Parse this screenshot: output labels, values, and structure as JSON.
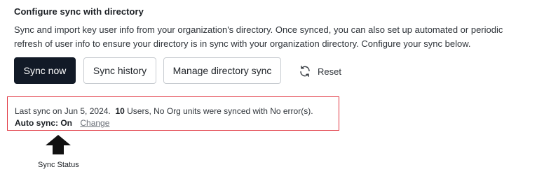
{
  "section": {
    "title": "Configure sync with directory",
    "description": "Sync and import key user info from your organization's directory. Once synced, you can also set up automated or periodic refresh of user info to ensure your directory is in sync with your organization directory. Configure your sync below."
  },
  "actions": {
    "sync_now": "Sync now",
    "sync_history": "Sync history",
    "manage_directory_sync": "Manage directory sync",
    "reset": "Reset"
  },
  "status": {
    "last_sync_prefix": "Last sync on Jun 5, 2024.",
    "users_count": "10",
    "summary": "Users, No Org units were synced with No error(s).",
    "auto_sync_label": "Auto sync: On",
    "change_link": "Change"
  },
  "annotation": {
    "label": "Sync Status",
    "arrow_icon": "up-arrow-icon",
    "highlight_color": "#e0343f"
  },
  "colors": {
    "primary_button": "#121a27",
    "border": "#c8ccd1"
  }
}
